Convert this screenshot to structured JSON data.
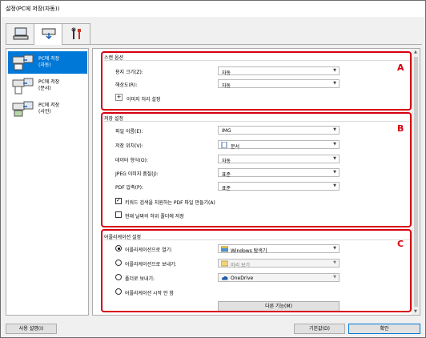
{
  "window": {
    "title": "설정(PC에 저장(자동))"
  },
  "tabs": [
    {
      "icon": "computer-icon",
      "active": false
    },
    {
      "icon": "scan-to-pc-icon",
      "active": true
    },
    {
      "icon": "tools-icon",
      "active": false
    }
  ],
  "sidebar": {
    "items": [
      {
        "label": "PC에 저장\n(자동)",
        "selected": true
      },
      {
        "label": "PC에 저장\n(문서)",
        "selected": false
      },
      {
        "label": "PC에 저장\n(사진)",
        "selected": false
      }
    ]
  },
  "scan_options": {
    "title": "스캔 옵션",
    "paper_size_label": "용지 크기(Z):",
    "paper_size_value": "자동",
    "resolution_label": "해상도(R):",
    "resolution_value": "자동",
    "image_processing_label": "이미지 처리 설정"
  },
  "save_settings": {
    "title": "저장 설정",
    "file_name_label": "파일 이름(E):",
    "file_name_value": "IMG",
    "save_in_label": "저장 위치(V):",
    "save_in_value": "문서",
    "data_format_label": "데이터 형식(O):",
    "data_format_value": "자동",
    "jpeg_quality_label": "JPEG 이미지 품질(J):",
    "jpeg_quality_value": "표준",
    "pdf_compression_label": "PDF 압축(P):",
    "pdf_compression_value": "표준",
    "keyword_pdf_label": "키워드 검색을 지원하는 PDF 파일 만들기(A)",
    "keyword_pdf_checked": true,
    "subfolder_label": "현재 날짜의 하위 폴더에 저장",
    "subfolder_checked": false
  },
  "app_settings": {
    "title": "어플리케이션 설정",
    "open_with_label": "어플리케이션으로 열기:",
    "open_with_value": "Windows 탐색기",
    "send_to_app_label": "어플리케이션으로 보내기:",
    "send_to_app_value": "미리 보기",
    "send_to_folder_label": "폴더로 보내기:",
    "send_to_folder_value": "OneDrive",
    "no_app_label": "어플리케이션 시작 안 함",
    "selected_option": "open_with",
    "more_functions_label": "다른 기능(M)"
  },
  "callouts": {
    "a": "A",
    "b": "B",
    "c": "C"
  },
  "footer": {
    "instructions_label": "사용 설명(I)",
    "defaults_label": "기본값(D)",
    "ok_label": "확인"
  }
}
